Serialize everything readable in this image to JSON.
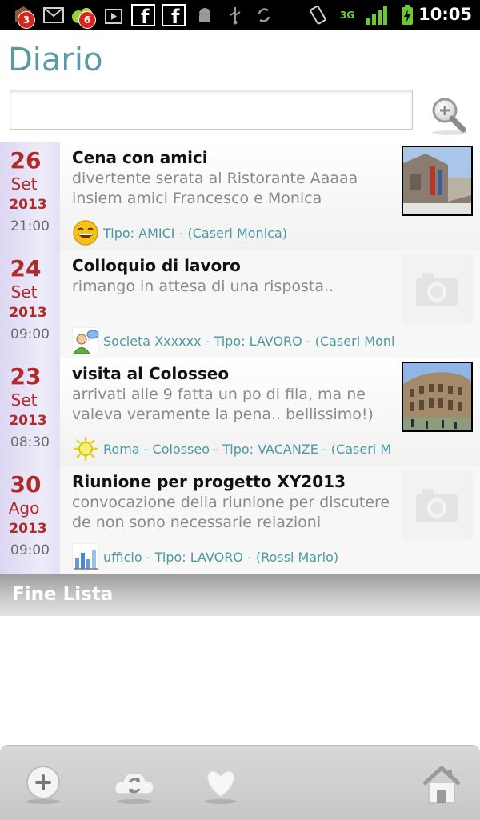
{
  "statusbar": {
    "badge_1": "3",
    "badge_2": "6",
    "network": "3G",
    "time": "10:05"
  },
  "header": {
    "title": "Diario",
    "search": {
      "value": "",
      "placeholder": ""
    }
  },
  "entries": [
    {
      "day": "26",
      "month": "Set",
      "year": "2013",
      "time": "21:00",
      "title": "Cena con amici",
      "desc": "divertente serata al Ristorante Aaaaa insiem amici Francesco e Monica",
      "footer": "Tipo: AMICI - (Caseri Monica)",
      "mood_icon": "laughing-face-icon",
      "photo": "photo-thumbnail"
    },
    {
      "day": "24",
      "month": "Set",
      "year": "2013",
      "time": "09:00",
      "title": "Colloquio di lavoro",
      "desc": "rimango in attesa di una risposta..",
      "footer": "Societa Xxxxxx - Tipo: LAVORO - (Caseri Moni",
      "mood_icon": "user-chat-icon",
      "photo": "camera-placeholder-icon"
    },
    {
      "day": "23",
      "month": "Set",
      "year": "2013",
      "time": "08:30",
      "title": "visita al Colosseo",
      "desc": "arrivati alle 9 fatta un po di fila, ma ne valeva veramente la pena.. bellissimo!)",
      "footer": "Roma - Colosseo - Tipo: VACANZE - (Caseri M",
      "mood_icon": "sun-icon",
      "photo": "photo-thumbnail"
    },
    {
      "day": "30",
      "month": "Ago",
      "year": "2013",
      "time": "09:00",
      "title": "Riunione per progetto XY2013",
      "desc": "convocazione della riunione per discutere de non sono necessarie relazioni specifiche.",
      "footer": "ufficio - Tipo: LAVORO - (Rossi Mario)",
      "mood_icon": "bar-chart-icon",
      "photo": "camera-placeholder-icon"
    }
  ],
  "list_end": "Fine Lista",
  "bottombar": {
    "add": "add-icon",
    "sync": "cloud-sync-icon",
    "favorite": "heart-icon",
    "home": "home-icon"
  },
  "colors": {
    "title": "#5a9aa2",
    "date": "#b02a2a",
    "footer_text": "#4a9aa2",
    "date_column": "#e8e4f7"
  }
}
